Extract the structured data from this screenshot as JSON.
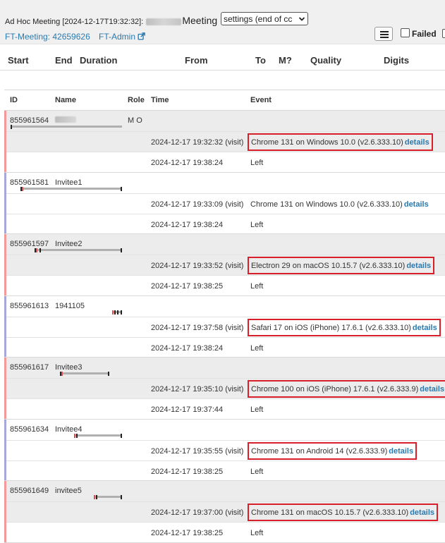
{
  "header": {
    "title_prefix": "Ad Hoc Meeting [2024-12-17T19:32:32]:",
    "title_suffix": "Meeting",
    "settings_select": "settings (end of cc",
    "ft_meeting_link": "FT-Meeting: 42659626",
    "ft_admin_link": "FT-Admin",
    "failed_label": "Failed"
  },
  "summary_columns": [
    "Start",
    "End",
    "Duration",
    "From",
    "To",
    "M?",
    "Quality",
    "Digits"
  ],
  "participant_columns": [
    "ID",
    "Name",
    "Role",
    "Time",
    "Event"
  ],
  "participants": [
    {
      "id": "855961564",
      "name": "",
      "role": "M O",
      "bar_color": "#f29a9a",
      "shaded": true,
      "events": [
        {
          "time": "2024-12-17 19:32:32 (visit)",
          "event": "Chrome 131 on Windows 10.0 (v2.6.333.10)",
          "details": "details",
          "highlighted": true
        },
        {
          "time": "2024-12-17 19:38:24",
          "event": "Left"
        }
      ]
    },
    {
      "id": "855961581",
      "name": "Invitee1",
      "role": "",
      "bar_color": "#a8a6d8",
      "shaded": false,
      "events": [
        {
          "time": "2024-12-17 19:33:09 (visit)",
          "event": "Chrome 131 on Windows 10.0 (v2.6.333.10)",
          "details": "details",
          "highlighted": false
        },
        {
          "time": "2024-12-17 19:38:24",
          "event": "Left"
        }
      ]
    },
    {
      "id": "855961597",
      "name": "Invitee2",
      "role": "",
      "bar_color": "#f29a9a",
      "shaded": true,
      "events": [
        {
          "time": "2024-12-17 19:33:52 (visit)",
          "event": "Electron 29 on macOS 10.15.7 (v2.6.333.10)",
          "details": "details",
          "highlighted": true
        },
        {
          "time": "2024-12-17 19:38:25",
          "event": "Left"
        }
      ]
    },
    {
      "id": "855961613",
      "name": "1941105",
      "role": "",
      "bar_color": "#a8a6d8",
      "shaded": false,
      "events": [
        {
          "time": "2024-12-17 19:37:58 (visit)",
          "event": "Safari 17 on iOS (iPhone) 17.6.1 (v2.6.333.10)",
          "details": "details",
          "highlighted": true
        },
        {
          "time": "2024-12-17 19:38:24",
          "event": "Left"
        }
      ]
    },
    {
      "id": "855961617",
      "name": "Invitee3",
      "role": "",
      "bar_color": "#f29a9a",
      "shaded": true,
      "events": [
        {
          "time": "2024-12-17 19:35:10 (visit)",
          "event": "Chrome 100 on iOS (iPhone) 17.6.1 (v2.6.333.9)",
          "details": "details",
          "highlighted": true
        },
        {
          "time": "2024-12-17 19:37:44",
          "event": "Left"
        }
      ]
    },
    {
      "id": "855961634",
      "name": "Invitee4",
      "role": "",
      "bar_color": "#a8a6d8",
      "shaded": false,
      "events": [
        {
          "time": "2024-12-17 19:35:55 (visit)",
          "event": "Chrome 131 on Android 14 (v2.6.333.9)",
          "details": "details",
          "highlighted": true
        },
        {
          "time": "2024-12-17 19:38:25",
          "event": "Left"
        }
      ]
    },
    {
      "id": "855961649",
      "name": "invitee5",
      "role": "",
      "bar_color": "#f29a9a",
      "shaded": true,
      "events": [
        {
          "time": "2024-12-17 19:37:00 (visit)",
          "event": "Chrome 131 on macOS 10.15.7 (v2.6.333.10)",
          "details": "details",
          "highlighted": true
        },
        {
          "time": "2024-12-17 19:38:25",
          "event": "Left"
        }
      ]
    }
  ],
  "colors": {
    "link": "#2a7ab0",
    "highlight_border": "#d9202a",
    "host_bar": "#f29a9a",
    "guest_bar": "#a8a6d8"
  }
}
